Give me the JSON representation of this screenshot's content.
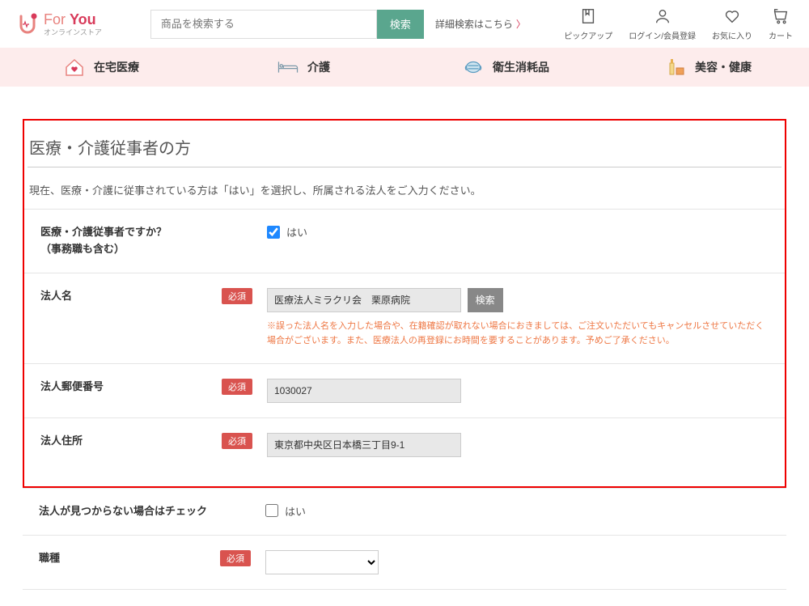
{
  "header": {
    "logo_main_for": "For ",
    "logo_main_you": "You",
    "logo_sub": "オンラインストア",
    "search_placeholder": "商品を検索する",
    "search_btn": "検索",
    "adv_search": "詳細検索はこちら",
    "icons": {
      "pickup": "ピックアップ",
      "login": "ログイン/会員登録",
      "fav": "お気に入り",
      "cart": "カート"
    }
  },
  "nav": {
    "home_care": "在宅医療",
    "nursing": "介護",
    "hygiene": "衛生消耗品",
    "beauty": "美容・健康"
  },
  "section": {
    "title": "医療・介護従事者の方",
    "desc": "現在、医療・介護に従事されている方は「はい」を選択し、所属される法人をご入力ください。",
    "required_badge": "必須",
    "rows": {
      "is_worker": {
        "label": "医療・介護従事者ですか？\n（事務職も含む）",
        "checkbox_label": "はい",
        "checked": true
      },
      "corp_name": {
        "label": "法人名",
        "value": "医療法人ミラクリ会　栗原病院",
        "search_btn": "検索",
        "warn": "※誤った法人名を入力した場合や、在籍確認が取れない場合におきましては、ご注文いただいてもキャンセルさせていただく場合がございます。また、医療法人の再登録にお時間を要することがあります。予めご了承ください。"
      },
      "corp_zip": {
        "label": "法人郵便番号",
        "value": "1030027"
      },
      "corp_addr": {
        "label": "法人住所",
        "value": "東京都中央区日本橋三丁目9-1"
      },
      "corp_notfound": {
        "label": "法人が見つからない場合はチェック",
        "checkbox_label": "はい",
        "checked": false
      },
      "job_type": {
        "label": "職種",
        "value": ""
      }
    }
  }
}
